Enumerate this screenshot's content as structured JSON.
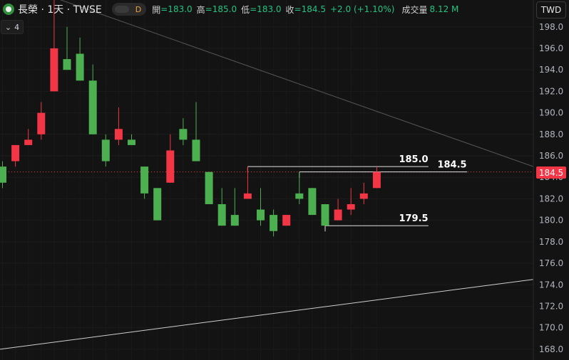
{
  "header": {
    "symbol": "長榮 · 1天 · TWSE",
    "badge": "D",
    "open_label": "開",
    "open": "=183.0",
    "high_label": "高",
    "high": "=185.0",
    "low_label": "低",
    "low": "=183.0",
    "close_label": "收",
    "close": "=184.5",
    "change": "+2.0 (+1.10%)",
    "volume_label": "成交量",
    "volume": "8.12 M"
  },
  "indicator_toggle": "4",
  "currency": "TWD",
  "price_tag": "184.5",
  "colors": {
    "up": "#f23645",
    "down": "#4caf50",
    "bg": "#131313"
  },
  "chart_data": {
    "type": "candlestick",
    "ylim": [
      167.0,
      200.5
    ],
    "yticks": [
      "168.0",
      "170.0",
      "172.0",
      "174.0",
      "176.0",
      "178.0",
      "180.0",
      "182.0",
      "184.0",
      "186.0",
      "188.0",
      "190.0",
      "192.0",
      "194.0",
      "196.0",
      "198.0"
    ],
    "candles": [
      {
        "o": 185.0,
        "h": 185.5,
        "c": 183.5,
        "l": 183.0
      },
      {
        "o": 185.5,
        "h": 187.0,
        "c": 187.0,
        "l": 185.0
      },
      {
        "o": 187.0,
        "h": 188.5,
        "c": 187.5,
        "l": 187.0
      },
      {
        "o": 188.0,
        "h": 191.0,
        "c": 190.0,
        "l": 187.5
      },
      {
        "o": 192.0,
        "h": 200.5,
        "c": 196.0,
        "l": 192.0
      },
      {
        "o": 195.0,
        "h": 198.0,
        "c": 194.0,
        "l": 194.0
      },
      {
        "o": 195.5,
        "h": 197.0,
        "c": 193.0,
        "l": 193.0
      },
      {
        "o": 193.0,
        "h": 194.5,
        "c": 188.0,
        "l": 188.0
      },
      {
        "o": 187.5,
        "h": 188.0,
        "c": 185.5,
        "l": 185.0
      },
      {
        "o": 187.5,
        "h": 190.5,
        "c": 188.5,
        "l": 187.0
      },
      {
        "o": 187.5,
        "h": 188.0,
        "c": 187.0,
        "l": 187.0
      },
      {
        "o": 185.0,
        "h": 185.0,
        "c": 182.5,
        "l": 182.0
      },
      {
        "o": 183.0,
        "h": 183.0,
        "c": 180.0,
        "l": 180.0
      },
      {
        "o": 183.5,
        "h": 188.0,
        "c": 186.5,
        "l": 183.5
      },
      {
        "o": 188.5,
        "h": 189.5,
        "c": 187.5,
        "l": 187.0
      },
      {
        "o": 187.5,
        "h": 191.0,
        "c": 185.5,
        "l": 185.5
      },
      {
        "o": 184.5,
        "h": 184.5,
        "c": 181.5,
        "l": 181.5
      },
      {
        "o": 181.5,
        "h": 183.0,
        "c": 179.5,
        "l": 179.5
      },
      {
        "o": 180.5,
        "h": 183.0,
        "c": 179.5,
        "l": 179.5
      },
      {
        "o": 182.0,
        "h": 185.0,
        "c": 182.5,
        "l": 182.0
      },
      {
        "o": 181.0,
        "h": 183.0,
        "c": 180.0,
        "l": 179.5
      },
      {
        "o": 180.5,
        "h": 181.0,
        "c": 179.0,
        "l": 178.5
      },
      {
        "o": 179.5,
        "h": 180.5,
        "c": 180.5,
        "l": 179.5
      },
      {
        "o": 182.5,
        "h": 184.5,
        "c": 182.0,
        "l": 181.5
      },
      {
        "o": 183.0,
        "h": 183.0,
        "c": 180.5,
        "l": 180.5
      },
      {
        "o": 181.5,
        "h": 181.5,
        "c": 179.5,
        "l": 179.5
      },
      {
        "o": 180.0,
        "h": 182.0,
        "c": 181.0,
        "l": 180.0
      },
      {
        "o": 181.0,
        "h": 183.0,
        "c": 181.5,
        "l": 180.5
      },
      {
        "o": 182.0,
        "h": 183.5,
        "c": 182.5,
        "l": 181.5
      },
      {
        "o": 183.0,
        "h": 185.0,
        "c": 184.5,
        "l": 183.0
      }
    ],
    "last_price": 184.5,
    "annotations": [
      {
        "label": "185.0",
        "value": 185.0
      },
      {
        "label": "184.5",
        "value": 184.5
      },
      {
        "label": "179.5",
        "value": 179.5
      }
    ],
    "trendlines": [
      {
        "from": [
          0,
          202.5
        ],
        "to": [
          30,
          185.0
        ]
      },
      {
        "from": [
          0,
          168.0
        ],
        "to": [
          30,
          174.5
        ]
      }
    ]
  }
}
